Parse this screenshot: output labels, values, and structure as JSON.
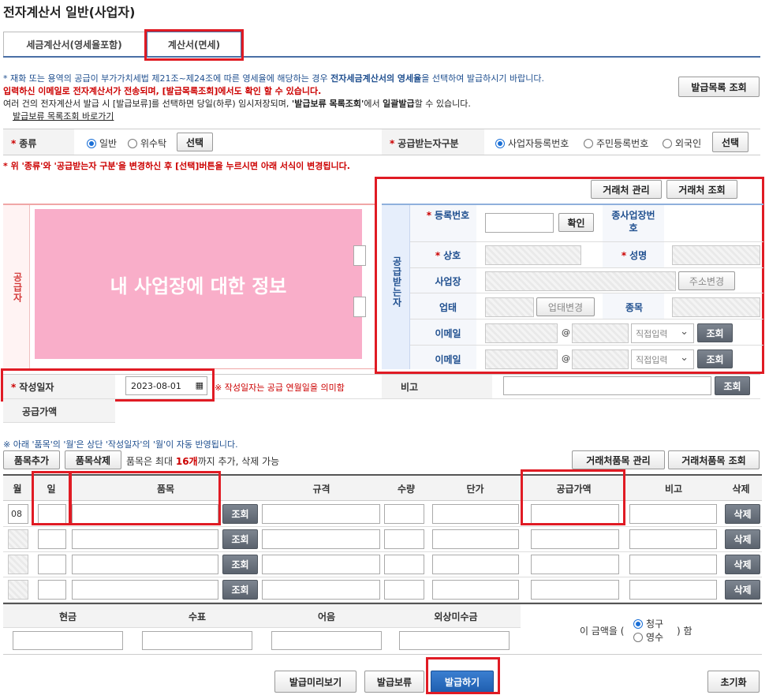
{
  "page": {
    "title": "전자계산서 일반(사업자)"
  },
  "tabs": [
    {
      "label": "세금계산서(영세율포함)"
    },
    {
      "label": "계산서(면세)"
    }
  ],
  "notices": {
    "line1_prefix": "* 재화 또는 용역의 공급이 부가가치세법 제21조~제24조에 따른 영세율에 해당하는 경우 ",
    "line1_bold": "전자세금계산서의 영세율",
    "line1_suffix": "을 선택하여 발급하시기 바랍니다.",
    "line2": "입력하신 이메일로 전자계산서가 전송되며, [발급목록조회]에서도 확인 할 수 있습니다.",
    "line3_prefix": "여러 건의 전자계산서 발급 시 [발급보류]를 선택하면 당일(하루) 임시저장되며, ",
    "line3_bold1": "'발급보류 목록조회'",
    "line3_mid": "에서 ",
    "line3_bold2": "일괄발급",
    "line3_suffix": "할 수 있습니다.",
    "link": "발급보류 목록조회 바로가기",
    "warning": "* 위 '종류'와 '공급받는자 구분'을 변경하신 후 [선택]버튼을 누르시면 아래 서식이 변경됩니다.",
    "month_note": "※ 아래 '품목'의 '월'은 상단 '작성일자'의 '월'이 자동 반영됩니다.",
    "date_note": "※ 작성일자는 공급 연월일을 의미함"
  },
  "buttons": {
    "issue_list": "발급목록 조회",
    "select": "선택",
    "client_manage": "거래처 관리",
    "client_search": "거래처 조회",
    "confirm": "확인",
    "address_change": "주소변경",
    "business_change": "업태변경",
    "lookup": "조회",
    "item_add": "품목추가",
    "item_delete": "품목삭제",
    "client_item_manage": "거래처품목 관리",
    "client_item_search": "거래처품목 조회",
    "delete": "삭제",
    "preview": "발급미리보기",
    "hold": "발급보류",
    "issue": "발급하기",
    "reset": "초기화"
  },
  "kind": {
    "label": "종류",
    "options": [
      "일반",
      "위수탁"
    ],
    "selected": "일반"
  },
  "receiver_type": {
    "label": "공급받는자구분",
    "options": [
      "사업자등록번호",
      "주민등록번호",
      "외국인"
    ],
    "selected": "사업자등록번호"
  },
  "supplier": {
    "side_label": "공급자",
    "overlay": "내 사업장에 대한 정보"
  },
  "receiver": {
    "side_label": "공급받는자",
    "reg_no": "등록번호",
    "sub_no": "종사업장번호",
    "company": "상호",
    "name": "성명",
    "address": "사업장",
    "business": "업태",
    "item_type": "종목",
    "email": "이메일",
    "email_select": "직접입력",
    "at": "@"
  },
  "date": {
    "label": "작성일자",
    "value": "2023-08-01"
  },
  "remark": {
    "label": "비고"
  },
  "supply_amount": {
    "label": "공급가액"
  },
  "item_limit": {
    "prefix": "품목은 최대 ",
    "count": "16개",
    "suffix": "까지 추가, 삭제 가능"
  },
  "item_table": {
    "headers": [
      "월",
      "일",
      "품목",
      "규격",
      "수량",
      "단가",
      "공급가액",
      "비고",
      "삭제"
    ],
    "rows": [
      {
        "month": "08"
      },
      {
        "month": ""
      },
      {
        "month": ""
      },
      {
        "month": ""
      }
    ]
  },
  "payment": {
    "headers": [
      "현금",
      "수표",
      "어음",
      "외상미수금"
    ],
    "amount_prefix": "이 금액을 (",
    "amount_suffix": ") 함",
    "options": [
      "청구",
      "영수"
    ],
    "selected": "청구"
  },
  "colors": {
    "accent": "#1f5fb0",
    "highlight": "#e01b24",
    "overlay": "#f9aec9"
  }
}
